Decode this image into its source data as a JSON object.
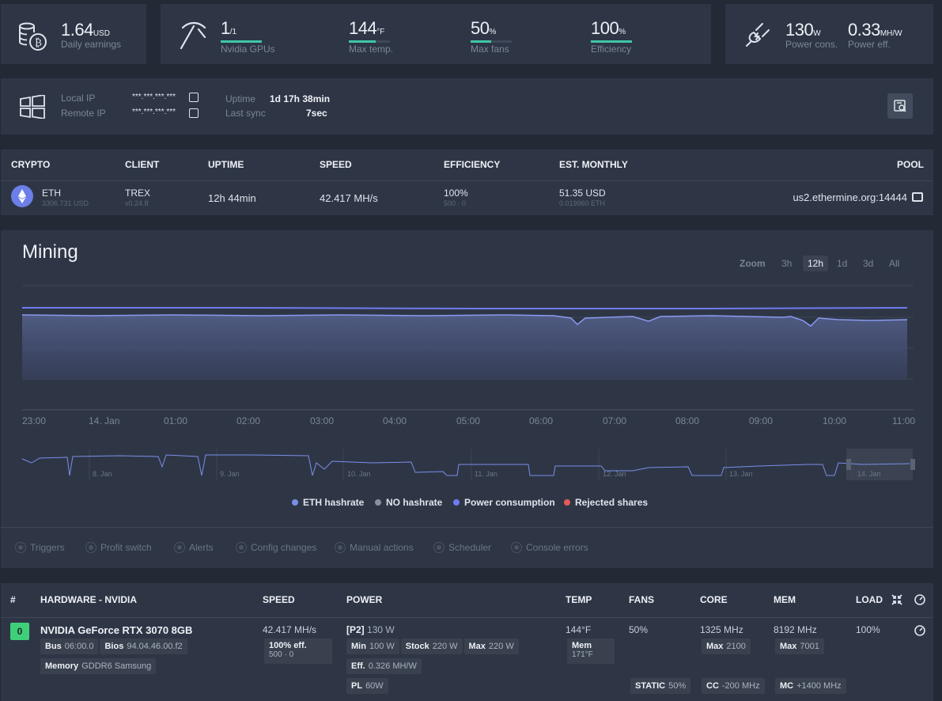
{
  "summary": {
    "earnings_value": "1.64",
    "earnings_unit": "USD",
    "earnings_label": "Daily earnings",
    "gpus_value": "1",
    "gpus_total": "/1",
    "gpus_label": "Nvidia GPUs",
    "gpus_fraction": 1.0,
    "temp_value": "144",
    "temp_unit": "°F",
    "temp_label": "Max temp.",
    "temp_fraction": 0.65,
    "fans_value": "50",
    "fans_unit": "%",
    "fans_label": "Max fans",
    "fans_fraction": 0.5,
    "eff_value": "100",
    "eff_unit": "%",
    "eff_label": "Efficiency",
    "eff_fraction": 1.0,
    "power_value": "130",
    "power_unit": "W",
    "power_label": "Power cons.",
    "peff_value": "0.33",
    "peff_unit": "MH/W",
    "peff_label": "Power eff."
  },
  "network": {
    "local_ip_label": "Local IP",
    "local_ip": "***.***.***.***",
    "remote_ip_label": "Remote IP",
    "remote_ip": "***.***.***.***",
    "uptime_label": "Uptime",
    "uptime": "1d 17h 38min",
    "sync_label": "Last sync",
    "sync": "7sec"
  },
  "crypto_table": {
    "headers": {
      "crypto": "CRYPTO",
      "client": "CLIENT",
      "uptime": "UPTIME",
      "speed": "SPEED",
      "efficiency": "EFFICIENCY",
      "monthly": "EST. MONTHLY",
      "pool": "POOL"
    },
    "row": {
      "coin": "ETH",
      "coin_sub": "3306.731 USD",
      "client": "TREX",
      "client_sub": "v0.24.8",
      "uptime": "12h 44min",
      "speed": "42.417 MH/s",
      "eff": "100%",
      "eff_sub": "500 · 0",
      "monthly": "51.35 USD",
      "monthly_sub": "0.019960 ETH",
      "pool": "us2.ethermine.org:14444"
    }
  },
  "chart": {
    "title": "Mining",
    "zoom_label": "Zoom",
    "ranges": [
      "3h",
      "12h",
      "1d",
      "3d",
      "All"
    ],
    "active_range": "12h",
    "x_ticks": [
      "23:00",
      "14. Jan",
      "01:00",
      "02:00",
      "03:00",
      "04:00",
      "05:00",
      "06:00",
      "07:00",
      "08:00",
      "09:00",
      "10:00",
      "11:00"
    ],
    "navigator_ticks": [
      "8. Jan",
      "9. Jan",
      "10. Jan",
      "11. Jan",
      "12. Jan",
      "13. Jan",
      "14. Jan"
    ],
    "legend": [
      {
        "name": "ETH hashrate",
        "color": "#7b8ee8"
      },
      {
        "name": "NO hashrate",
        "color": "#8a8f99"
      },
      {
        "name": "Power consumption",
        "color": "#6f7bf0"
      },
      {
        "name": "Rejected shares",
        "color": "#e55a5a"
      }
    ]
  },
  "events": [
    "Triggers",
    "Profit switch",
    "Alerts",
    "Config changes",
    "Manual actions",
    "Scheduler",
    "Console errors"
  ],
  "gpu_table": {
    "headers": {
      "num": "#",
      "hardware": "HARDWARE - NVIDIA",
      "speed": "SPEED",
      "power": "POWER",
      "temp": "TEMP",
      "fans": "FANS",
      "core": "CORE",
      "mem": "MEM",
      "load": "LOAD"
    },
    "row": {
      "index": "0",
      "name": "NVIDIA GeForce RTX 3070 8GB",
      "bus_label": "Bus",
      "bus": "06:00.0",
      "bios_label": "Bios",
      "bios": "94.04.46.00.f2",
      "memory_label": "Memory",
      "memory": "GDDR6 Samsung",
      "speed": "42.417 MH/s",
      "eff": "100% eff.",
      "eff_sub": "500 · 0",
      "pstate": "[P2]",
      "power": "130 W",
      "min_label": "Min",
      "min": "100 W",
      "stock_label": "Stock",
      "stock": "220 W",
      "max_label": "Max",
      "max": "220 W",
      "peff_label": "Eff.",
      "peff": "0.326 MH/W",
      "pl_label": "PL",
      "pl": "60W",
      "temp": "144°F",
      "memtemp_label": "Mem",
      "memtemp": "171°F",
      "fans": "50%",
      "fan_mode": "STATIC",
      "fan_mode_val": "50%",
      "core": "1325 MHz",
      "core_max_label": "Max",
      "core_max": "2100",
      "cc_label": "CC",
      "cc": "-200 MHz",
      "mem": "8192 MHz",
      "mem_max_label": "Max",
      "mem_max": "7001",
      "mc_label": "MC",
      "mc": "+1400 MHz",
      "load": "100%"
    }
  }
}
